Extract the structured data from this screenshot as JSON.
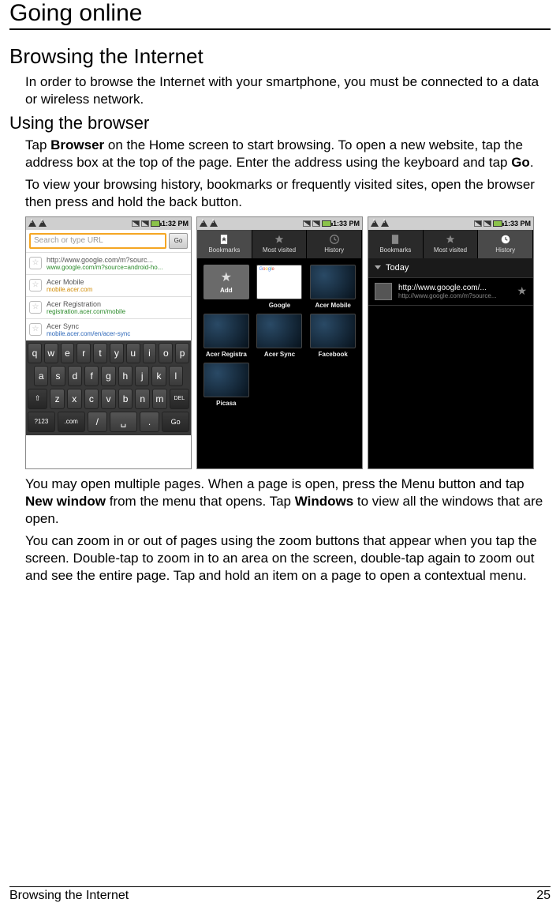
{
  "page": {
    "title": "Going online",
    "section": "Browsing the Internet",
    "intro": "In order to browse the Internet with your smartphone, you must be connected to a data or wireless network.",
    "subsection": "Using the browser",
    "p1a": "Tap ",
    "p1b_bold": "Browser",
    "p1c": " on the Home screen to start browsing. To open a new website, tap the address box at the top of the page. Enter the address using the keyboard and tap ",
    "p1d_bold": "Go",
    "p1e": ".",
    "p2": "To view your browsing history, bookmarks or frequently visited sites, open the browser then press and hold the back button.",
    "p3a": "You may open multiple pages. When a page is open, press the Menu button and tap ",
    "p3b_bold": "New window",
    "p3c": " from the menu that opens. Tap ",
    "p3d_bold": "Windows",
    "p3e": " to view all the windows that are open.",
    "p4": "You can zoom in or out of pages using the zoom buttons that appear when you tap the screen. Double-tap to zoom in to an area on the screen, double-tap again to zoom out and see the entire page. Tap and hold an item on a page to open a contextual menu."
  },
  "footer": {
    "left": "Browsing the Internet",
    "right": "25"
  },
  "screen1": {
    "time": "1:32 PM",
    "search_placeholder": "Search or type URL",
    "go": "Go",
    "suggestions": [
      {
        "title": "http://www.google.com/m?sourc...",
        "url": "www.google.com/m?source=android-ho...",
        "cls": "green"
      },
      {
        "title": "Acer Mobile",
        "url": "mobile.acer.com",
        "cls": "orange"
      },
      {
        "title": "Acer Registration",
        "url": "registration.acer.com/mobile",
        "cls": "green"
      },
      {
        "title": "Acer Sync",
        "url": "mobile.acer.com/en/acer-sync",
        "cls": "blue"
      }
    ],
    "kb": {
      "r1": [
        "q",
        "w",
        "e",
        "r",
        "t",
        "y",
        "u",
        "i",
        "o",
        "p"
      ],
      "r2": [
        "a",
        "s",
        "d",
        "f",
        "g",
        "h",
        "j",
        "k",
        "l"
      ],
      "r3_shift": "⇧",
      "r3": [
        "z",
        "x",
        "c",
        "v",
        "b",
        "n",
        "m"
      ],
      "r3_del": "DEL",
      "r4": [
        "?123",
        ".com",
        "/",
        "␣",
        ".",
        "Go"
      ]
    }
  },
  "screen2": {
    "time": "1:33 PM",
    "tabs": {
      "bookmarks": "Bookmarks",
      "most": "Most visited",
      "history": "History"
    },
    "add": "Add",
    "items": [
      "Google",
      "Acer Mobile",
      "Acer Registra",
      "Acer Sync",
      "Facebook",
      "Picasa"
    ]
  },
  "screen3": {
    "time": "1:33 PM",
    "tabs": {
      "bookmarks": "Bookmarks",
      "most": "Most visited",
      "history": "History"
    },
    "today": "Today",
    "item": {
      "title": "http://www.google.com/...",
      "url": "http://www.google.com/m?source..."
    }
  }
}
